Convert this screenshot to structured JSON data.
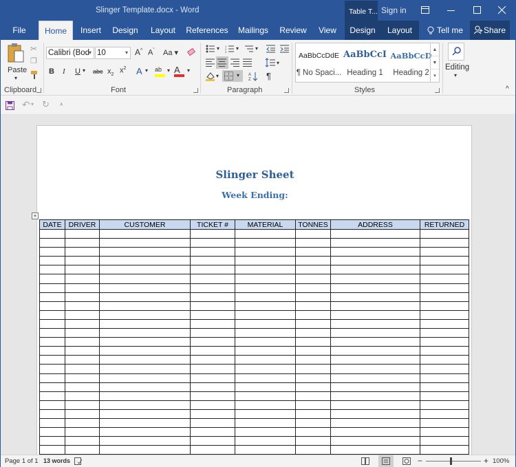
{
  "window": {
    "title": "Slinger Template.docx  -  Word",
    "context_tab_group": "Table T...",
    "sign_in": "Sign in"
  },
  "tabs": [
    "File",
    "Home",
    "Insert",
    "Design",
    "Layout",
    "References",
    "Mailings",
    "Review",
    "View",
    "Design",
    "Layout"
  ],
  "active_tab": "Home",
  "tell_me": "Tell me",
  "share": "Share",
  "ribbon": {
    "clipboard": {
      "paste": "Paste",
      "label": "Clipboard"
    },
    "font": {
      "name": "Calibri (Bod",
      "size": "10",
      "label": "Font",
      "case_label": "Aa"
    },
    "paragraph": {
      "label": "Paragraph"
    },
    "styles": {
      "label": "Styles",
      "items": [
        {
          "preview": "AaBbCcDdE",
          "name": "¶ No Spaci..."
        },
        {
          "preview": "AaBbCcI",
          "name": "Heading 1"
        },
        {
          "preview": "AaBbCcD",
          "name": "Heading 2"
        }
      ]
    },
    "editing": {
      "label": "Editing"
    }
  },
  "document": {
    "title": "Slinger Sheet",
    "subtitle": "Week Ending:",
    "columns": [
      "DATE",
      "DRIVER",
      "CUSTOMER",
      "TICKET #",
      "MATERIAL",
      "TONNES",
      "ADDRESS",
      "RETURNED"
    ],
    "empty_rows": 25
  },
  "status": {
    "page": "Page 1 of 1",
    "words": "13 words",
    "zoom": "100%"
  },
  "colors": {
    "title_bar": "#2b579a",
    "context_tabs": "#1e3f72",
    "table_header": "#c7d8ef",
    "heading_text": "#2e5e96"
  }
}
